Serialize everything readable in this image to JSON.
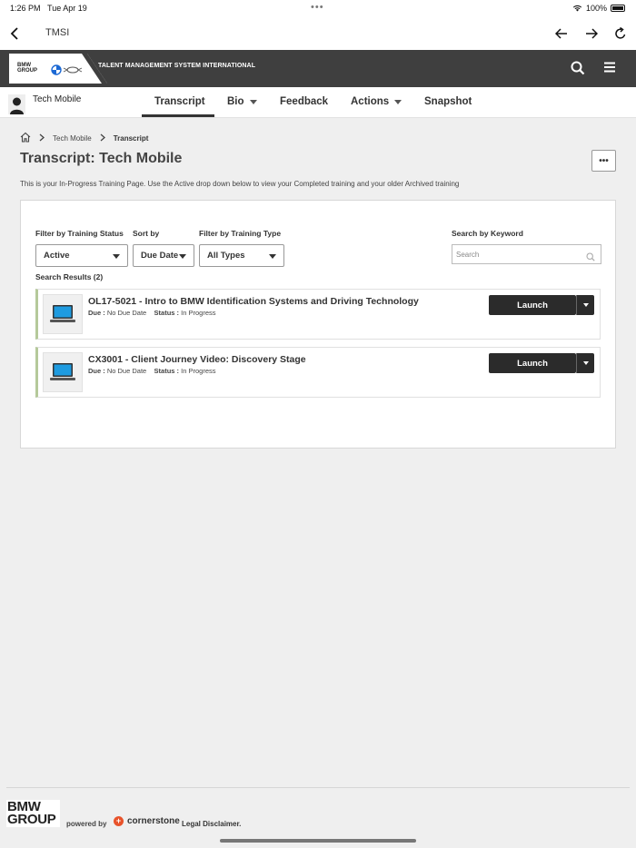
{
  "status_bar": {
    "time": "1:26 PM",
    "date": "Tue Apr 19",
    "battery": "100%"
  },
  "browser": {
    "title": "TMSI"
  },
  "brand": {
    "logo_text_line1": "BMW",
    "logo_text_line2": "GROUP",
    "system_name": "TALENT MANAGEMENT SYSTEM INTERNATIONAL"
  },
  "user": {
    "name": "Tech Mobile"
  },
  "tabs": [
    {
      "label": "Transcript"
    },
    {
      "label": "Bio"
    },
    {
      "label": "Feedback"
    },
    {
      "label": "Actions"
    },
    {
      "label": "Snapshot"
    }
  ],
  "breadcrumb": {
    "parent": "Tech Mobile",
    "current": "Transcript"
  },
  "page": {
    "title": "Transcript: Tech Mobile",
    "more_label": "•••",
    "intro": "This is your In-Progress Training Page. Use the Active drop down below to view your Completed training and your older Archived training"
  },
  "filters": {
    "status_label": "Filter by Training Status",
    "status_value": "Active",
    "sort_label": "Sort by",
    "sort_value": "Due Date",
    "type_label": "Filter by Training Type",
    "type_value": "All Types",
    "keyword_label": "Search by Keyword",
    "keyword_placeholder": "Search"
  },
  "results": {
    "label": "Search Results (2)",
    "items": [
      {
        "title": "OL17-5021 - Intro to BMW Identification Systems and Driving Technology",
        "due_label": "Due :",
        "due_value": "No Due Date",
        "status_label": "Status :",
        "status_value": "In Progress",
        "action": "Launch"
      },
      {
        "title": "CX3001 - Client Journey Video: Discovery Stage",
        "due_label": "Due :",
        "due_value": "No Due Date",
        "status_label": "Status :",
        "status_value": "In Progress",
        "action": "Launch"
      }
    ]
  },
  "footer": {
    "logo_line1": "BMW",
    "logo_line2": "GROUP",
    "powered_by": "powered by",
    "vendor": "cornerstone",
    "legal": "Legal Disclaimer."
  },
  "colors": {
    "header_bg": "#3f3f3f",
    "launch_bg": "#2b2b2b",
    "item_accent": "#b5c99a",
    "cornerstone_accent": "#e8532b"
  }
}
